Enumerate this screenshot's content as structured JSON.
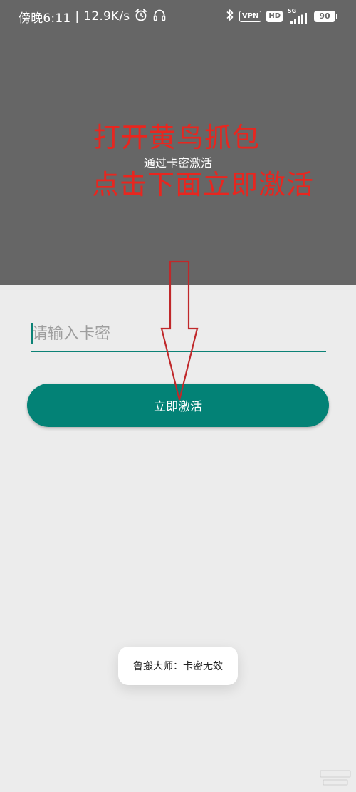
{
  "status_bar": {
    "time": "傍晚6:11",
    "separator": "|",
    "network_speed": "12.9K/s",
    "vpn_label": "VPN",
    "hd_label": "HD",
    "signal_label": "5G",
    "battery_level": "90",
    "icons": [
      "alarm-icon",
      "headset-icon",
      "bluetooth-icon",
      "signal-icon"
    ]
  },
  "header": {
    "title": "通过卡密激活"
  },
  "annotation": {
    "line1": "打开黄鸟抓包",
    "line2": "点击下面立即激活",
    "color": "#e8261f"
  },
  "form": {
    "code_placeholder": "请输入卡密",
    "code_value": "",
    "activate_label": "立即激活"
  },
  "toast": {
    "message": "鲁搬大师：卡密无效"
  },
  "colors": {
    "header_bg": "#666666",
    "page_bg": "#ececec",
    "accent": "#038276",
    "annotation": "#e8261f"
  }
}
